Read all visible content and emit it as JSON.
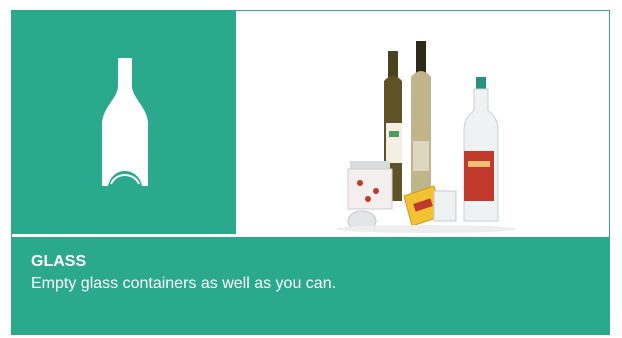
{
  "card": {
    "title": "GLASS",
    "description": "Empty glass containers as well as you can."
  },
  "colors": {
    "accent": "#2aa98c",
    "text": "#ffffff"
  },
  "icons": {
    "category_icon": "glass-bottle-icon"
  }
}
